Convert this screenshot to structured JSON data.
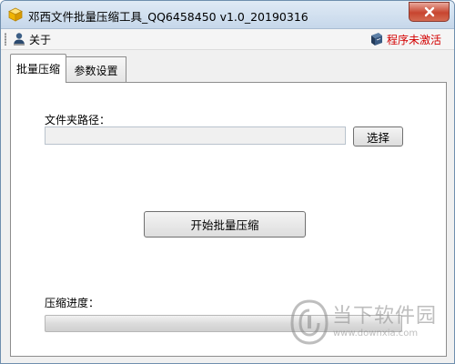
{
  "window": {
    "title": "邓西文件批量压缩工具_QQ6458450 v1.0_20190316",
    "app_icon": "box-icon",
    "close_icon": "close-icon"
  },
  "menu": {
    "about_label": "关于",
    "about_icon": "user-icon",
    "activation_status": "程序未激活",
    "activation_icon": "book-icon",
    "activation_color": "#d30000"
  },
  "tabs": [
    {
      "label": "批量压缩",
      "active": true
    },
    {
      "label": "参数设置",
      "active": false
    }
  ],
  "compress": {
    "folder_label": "文件夹路径：",
    "folder_value": "",
    "select_button": "选择",
    "start_button": "开始批量压缩",
    "progress_label": "压缩进度：",
    "progress_value": 0
  },
  "watermark": {
    "name": "当下软件园",
    "url": "www.downxia.com",
    "logo_icon": "downxia-logo-icon"
  }
}
